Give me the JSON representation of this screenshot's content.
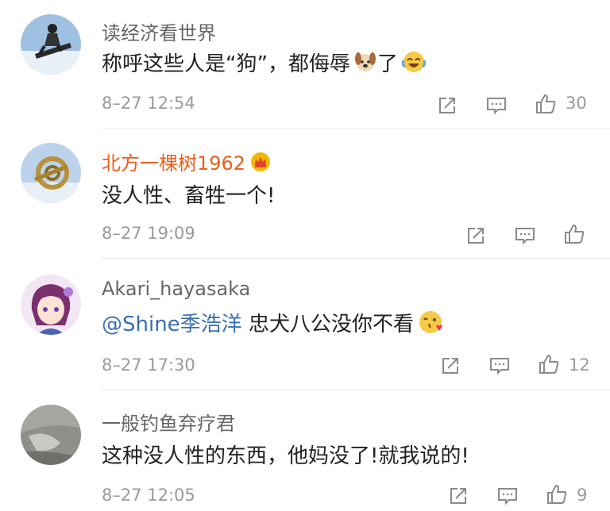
{
  "comments": [
    {
      "username": "读经济看世界",
      "text_main": "称呼这些人是“狗”，都侮辱",
      "text_tail": "了",
      "emojis": [
        "dog-face-emoji",
        "crying-laughing-emoji"
      ],
      "time": "8–27 12:54",
      "likes": "30",
      "icons": [
        "share-icon",
        "reply-icon",
        "like-icon"
      ]
    },
    {
      "username": "北方一棵树1962",
      "badge": "crown-badge-icon",
      "text_main": "没人性、畜牲一个!",
      "time": "8–27 19:09",
      "likes": "",
      "icons": [
        "share-icon",
        "reply-icon",
        "like-icon"
      ]
    },
    {
      "username": "Akari_hayasaka",
      "mention": "@Shine季浩洋",
      "text_main": " 忠犬八公没你不看",
      "emojis": [
        "blowing-kiss-emoji"
      ],
      "time": "8–27 17:30",
      "likes": "12",
      "icons": [
        "share-icon",
        "reply-icon",
        "like-icon"
      ]
    },
    {
      "username": "一般钓鱼弃疗君",
      "text_main": "这种没人性的东西，他妈没了!就我说的!",
      "time": "8–27 12:05",
      "likes": "9",
      "icons": [
        "share-icon",
        "reply-icon",
        "like-icon"
      ]
    }
  ],
  "colors": {
    "username": "#666666",
    "username_vip": "#e8601c",
    "mention": "#3a6fb0",
    "meta": "#9a9a9a",
    "divider": "#e6e6e6"
  }
}
